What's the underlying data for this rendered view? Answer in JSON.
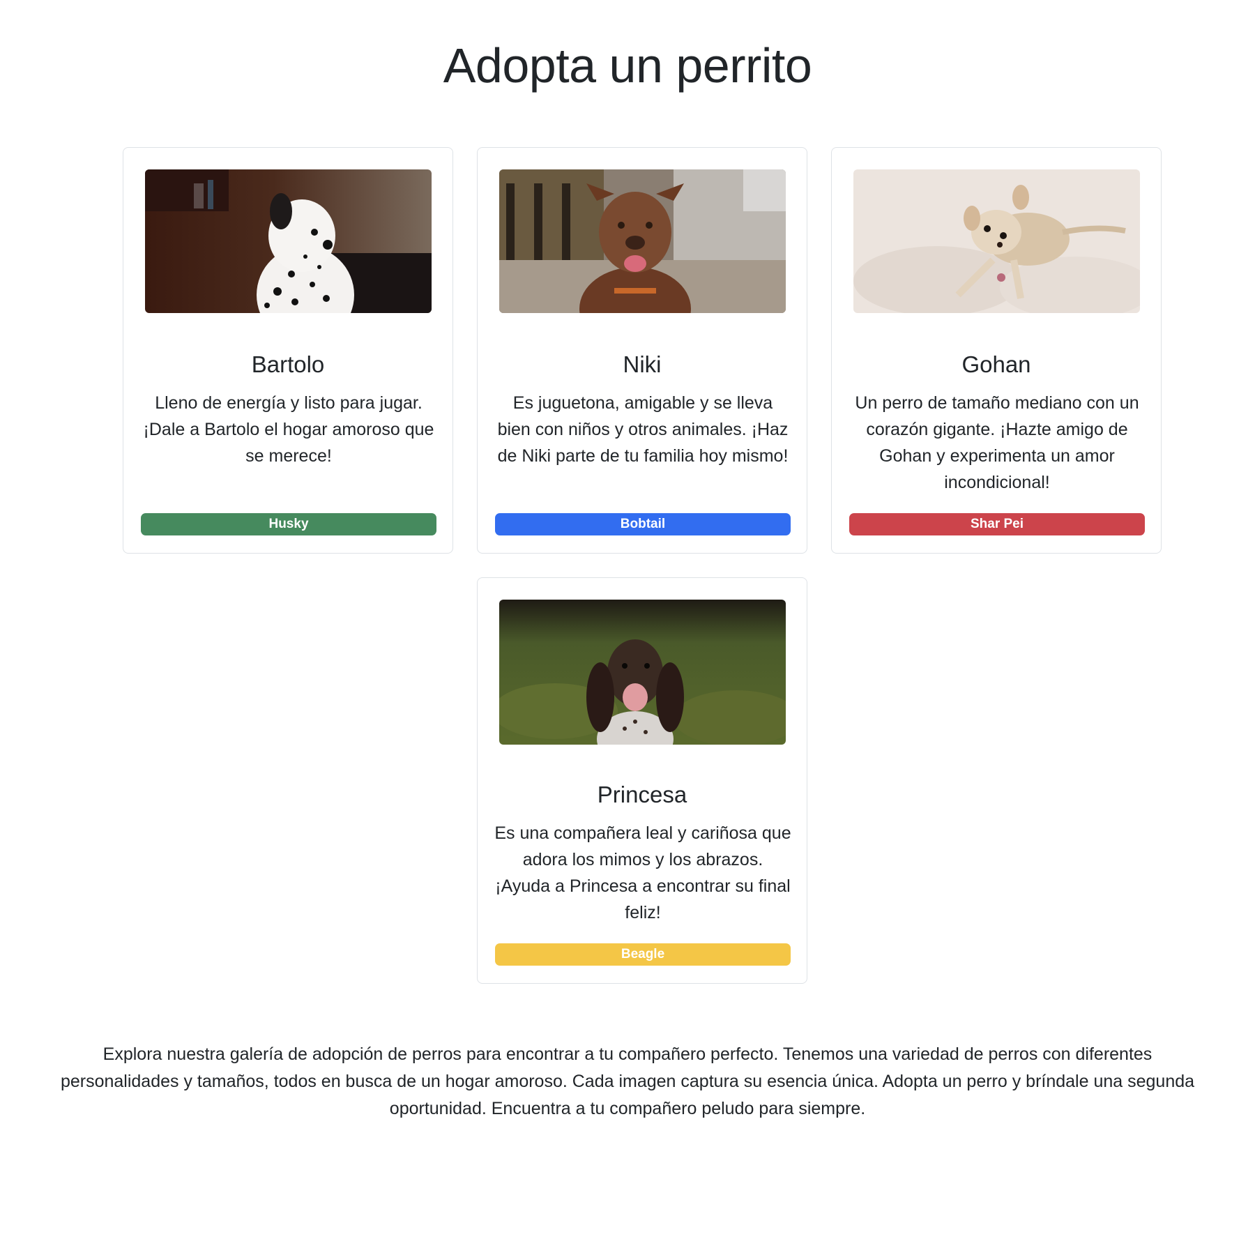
{
  "page": {
    "title": "Adopta un perrito"
  },
  "dogs": [
    {
      "name": "Bartolo",
      "description": "Lleno de energía y listo para jugar. ¡Dale a Bartolo el hogar amoroso que se merece!",
      "breed": "Husky",
      "badge_color": "#468a5e",
      "image_icon": "dalmatian-photo"
    },
    {
      "name": "Niki",
      "description": "Es juguetona, amigable y se lleva bien con niños y otros animales. ¡Haz de Niki parte de tu familia hoy mismo!",
      "breed": "Bobtail",
      "badge_color": "#326df0",
      "image_icon": "brown-dog-photo"
    },
    {
      "name": "Gohan",
      "description": "Un perro de tamaño mediano con un corazón gigante. ¡Hazte amigo de Gohan y experimenta un amor incondicional!",
      "breed": "Shar Pei",
      "badge_color": "#cc444b",
      "image_icon": "chihuahua-photo"
    },
    {
      "name": "Princesa",
      "description": "Es una compañera leal y cariñosa que adora los mimos y los abrazos. ¡Ayuda a Princesa a encontrar su final feliz!",
      "breed": "Beagle",
      "badge_color": "#f4c646",
      "image_icon": "pointer-puppy-photo"
    }
  ],
  "footer": {
    "text": "Explora nuestra galería de adopción de perros para encontrar a tu compañero perfecto. Tenemos una variedad de perros con diferentes personalidades y tamaños, todos en busca de un hogar amoroso. Cada imagen captura su esencia única. Adopta un perro y bríndale una segunda oportunidad. Encuentra a tu compañero peludo para siempre."
  }
}
